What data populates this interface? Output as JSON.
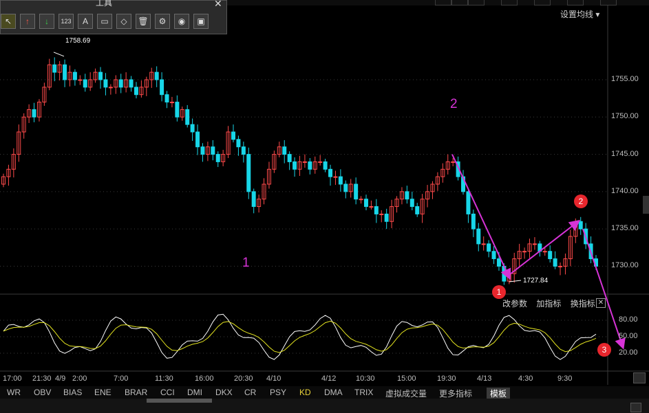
{
  "toolbar": {
    "title": "工具",
    "tools": [
      {
        "icon": "cursor-icon",
        "glyph": "↖"
      },
      {
        "icon": "arrow-up-icon",
        "glyph": "↑"
      },
      {
        "icon": "arrow-down-icon",
        "glyph": "↓"
      },
      {
        "icon": "number-tag-icon",
        "glyph": "123"
      },
      {
        "icon": "text-icon",
        "glyph": "A"
      },
      {
        "icon": "ruler-icon",
        "glyph": "▭"
      },
      {
        "icon": "eraser-icon",
        "glyph": "◇"
      },
      {
        "icon": "trash-icon",
        "glyph": "🗑"
      },
      {
        "icon": "settings-icon",
        "glyph": "⚙"
      },
      {
        "icon": "eye-icon",
        "glyph": "◉"
      },
      {
        "icon": "save-icon",
        "glyph": "▣"
      }
    ]
  },
  "header": {
    "set_ma": "设置均线 ▾"
  },
  "chart_data": {
    "type": "candlestick",
    "y_ticks": [
      "1755.00",
      "1750.00",
      "1745.00",
      "1740.00",
      "1735.00",
      "1730.00"
    ],
    "y_tick_values": [
      1755,
      1750,
      1745,
      1740,
      1735,
      1730
    ],
    "ylim": [
      1727,
      1762
    ],
    "high_label": "1758.69",
    "low_label": "1727.84",
    "x_ticks": [
      "17:00",
      "21:30",
      "4/9",
      "2:00",
      "7:00",
      "11:30",
      "16:00",
      "20:30",
      "4/10",
      "4/12",
      "10:30",
      "15:00",
      "19:30",
      "4/13",
      "4:30",
      "9:30"
    ],
    "wave_labels": [
      "1",
      "2"
    ],
    "markers": [
      "1",
      "2",
      "3"
    ],
    "indicator": {
      "name": "KD",
      "y_ticks": [
        "80.00",
        "50.00",
        "20.00"
      ],
      "y_tick_values": [
        80,
        50,
        20
      ]
    }
  },
  "indicator_controls": [
    "改参数",
    "加指标",
    "换指标"
  ],
  "indicator_tabs": [
    "WR",
    "OBV",
    "BIAS",
    "ENE",
    "BRAR",
    "CCI",
    "DMI",
    "DKX",
    "CR",
    "PSY",
    "KD",
    "DMA",
    "TRIX",
    "虚拟成交量",
    "更多指标",
    "模板"
  ],
  "colors": {
    "up": "#ff4a4a",
    "down": "#18d6e8",
    "k_line": "#ffffff",
    "d_line": "#e6e620",
    "annotation": "#d633d6",
    "marker": "#e8262d"
  }
}
